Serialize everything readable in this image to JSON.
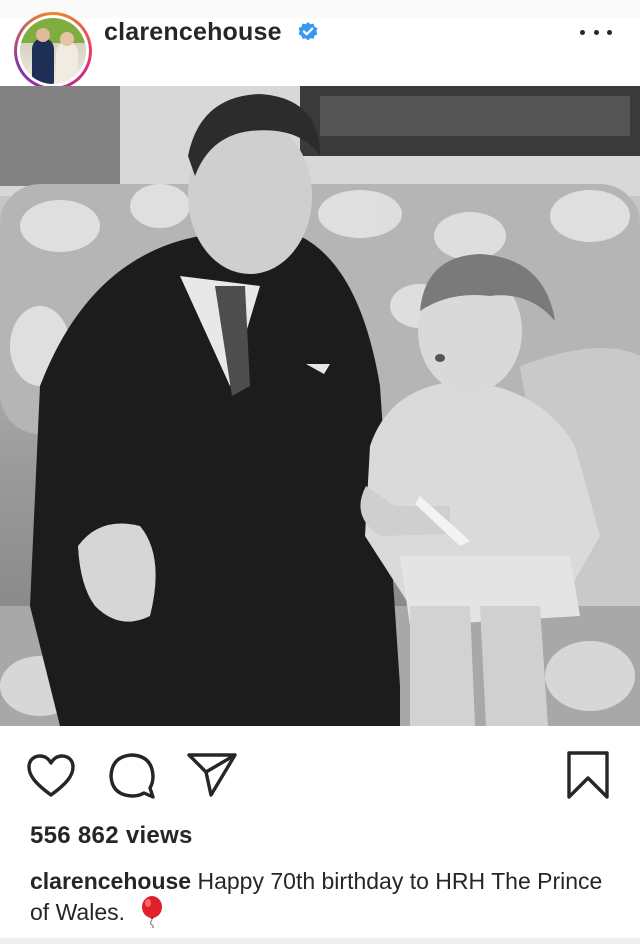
{
  "post": {
    "username": "clarencehouse",
    "views": "556 862 views",
    "caption_user": "clarencehouse",
    "caption_text": "Happy 70th birthday to HRH The Prince of Wales."
  },
  "icons": {
    "verified": "verified-badge-icon",
    "more": "more-options-icon",
    "like": "heart-icon",
    "comment": "comment-icon",
    "share": "send-icon",
    "save": "bookmark-icon",
    "emoji": "red-balloon-icon"
  },
  "colors": {
    "verified_blue": "#3897f0",
    "text": "#262626",
    "balloon_red": "#e0202a"
  }
}
